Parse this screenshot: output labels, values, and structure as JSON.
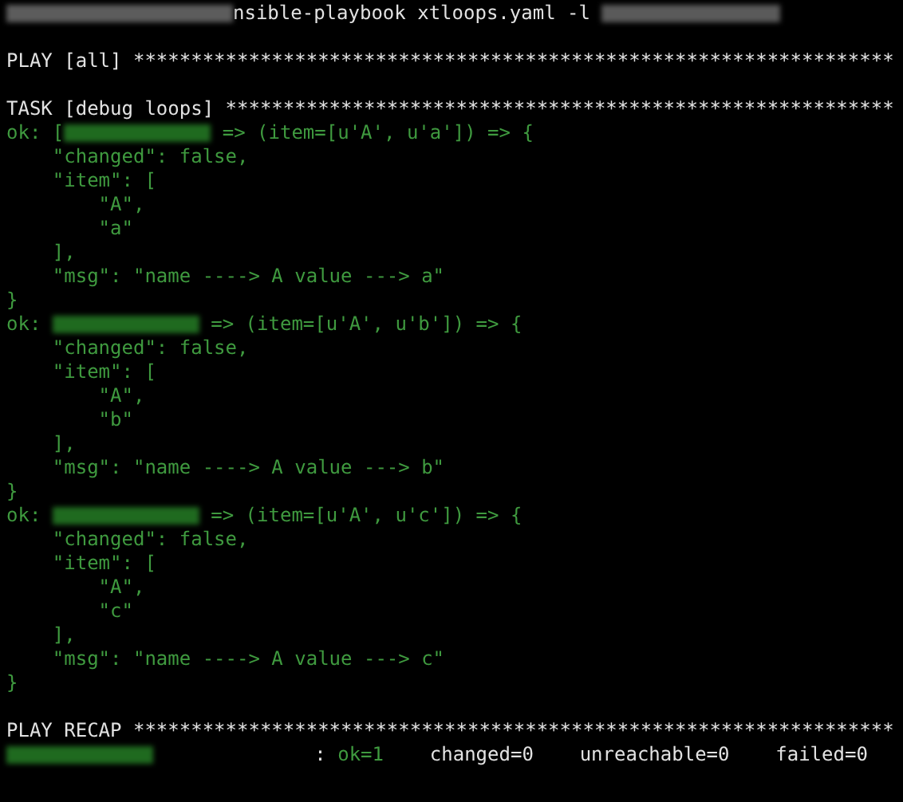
{
  "terminal": {
    "blocks": [
      {
        "lines": [
          {
            "segments": [
              {
                "kind": "mask-prompt"
              },
              {
                "kind": "plain",
                "text": "nsible-playbook xtloops.yaml -l "
              },
              {
                "kind": "mask-ip"
              }
            ]
          }
        ]
      },
      {
        "lines": [
          {
            "segments": [
              {
                "kind": "plain",
                "text": "PLAY [all] ******************************************************************"
              }
            ]
          }
        ]
      },
      {
        "lines": [
          {
            "segments": [
              {
                "kind": "plain",
                "text": "TASK [debug loops] **********************************************************"
              }
            ]
          },
          {
            "segments": [
              {
                "kind": "ok",
                "text": "ok: ["
              },
              {
                "kind": "mask-host"
              },
              {
                "kind": "ok",
                "text": " => (item=[u'A', u'a']) => {"
              }
            ]
          },
          {
            "segments": [
              {
                "kind": "ok",
                "text": "    \"changed\": false,"
              }
            ]
          },
          {
            "segments": [
              {
                "kind": "ok",
                "text": "    \"item\": ["
              }
            ]
          },
          {
            "segments": [
              {
                "kind": "ok",
                "text": "        \"A\","
              }
            ]
          },
          {
            "segments": [
              {
                "kind": "ok",
                "text": "        \"a\""
              }
            ]
          },
          {
            "segments": [
              {
                "kind": "ok",
                "text": "    ],"
              }
            ]
          },
          {
            "segments": [
              {
                "kind": "ok",
                "text": "    \"msg\": \"name ----> A value ---> a\""
              }
            ]
          },
          {
            "segments": [
              {
                "kind": "ok",
                "text": "}"
              }
            ]
          },
          {
            "segments": [
              {
                "kind": "ok",
                "text": "ok: "
              },
              {
                "kind": "mask-host"
              },
              {
                "kind": "ok",
                "text": " => (item=[u'A', u'b']) => {"
              }
            ]
          },
          {
            "segments": [
              {
                "kind": "ok",
                "text": "    \"changed\": false,"
              }
            ]
          },
          {
            "segments": [
              {
                "kind": "ok",
                "text": "    \"item\": ["
              }
            ]
          },
          {
            "segments": [
              {
                "kind": "ok",
                "text": "        \"A\","
              }
            ]
          },
          {
            "segments": [
              {
                "kind": "ok",
                "text": "        \"b\""
              }
            ]
          },
          {
            "segments": [
              {
                "kind": "ok",
                "text": "    ],"
              }
            ]
          },
          {
            "segments": [
              {
                "kind": "ok",
                "text": "    \"msg\": \"name ----> A value ---> b\""
              }
            ]
          },
          {
            "segments": [
              {
                "kind": "ok",
                "text": "}"
              }
            ]
          },
          {
            "segments": [
              {
                "kind": "ok",
                "text": "ok: "
              },
              {
                "kind": "mask-host"
              },
              {
                "kind": "ok",
                "text": " => (item=[u'A', u'c']) => {"
              }
            ]
          },
          {
            "segments": [
              {
                "kind": "ok",
                "text": "    \"changed\": false,"
              }
            ]
          },
          {
            "segments": [
              {
                "kind": "ok",
                "text": "    \"item\": ["
              }
            ]
          },
          {
            "segments": [
              {
                "kind": "ok",
                "text": "        \"A\","
              }
            ]
          },
          {
            "segments": [
              {
                "kind": "ok",
                "text": "        \"c\""
              }
            ]
          },
          {
            "segments": [
              {
                "kind": "ok",
                "text": "    ],"
              }
            ]
          },
          {
            "segments": [
              {
                "kind": "ok",
                "text": "    \"msg\": \"name ----> A value ---> c\""
              }
            ]
          },
          {
            "segments": [
              {
                "kind": "ok",
                "text": "}"
              }
            ]
          }
        ]
      },
      {
        "lines": [
          {
            "segments": [
              {
                "kind": "plain",
                "text": "PLAY RECAP ******************************************************************"
              }
            ]
          },
          {
            "segments": [
              {
                "kind": "mask-host-ok"
              },
              {
                "kind": "plain",
                "text": "              : "
              },
              {
                "kind": "ok",
                "text": "ok=1"
              },
              {
                "kind": "plain",
                "text": "    changed=0    unreachable=0    failed=0"
              }
            ]
          }
        ]
      }
    ]
  }
}
